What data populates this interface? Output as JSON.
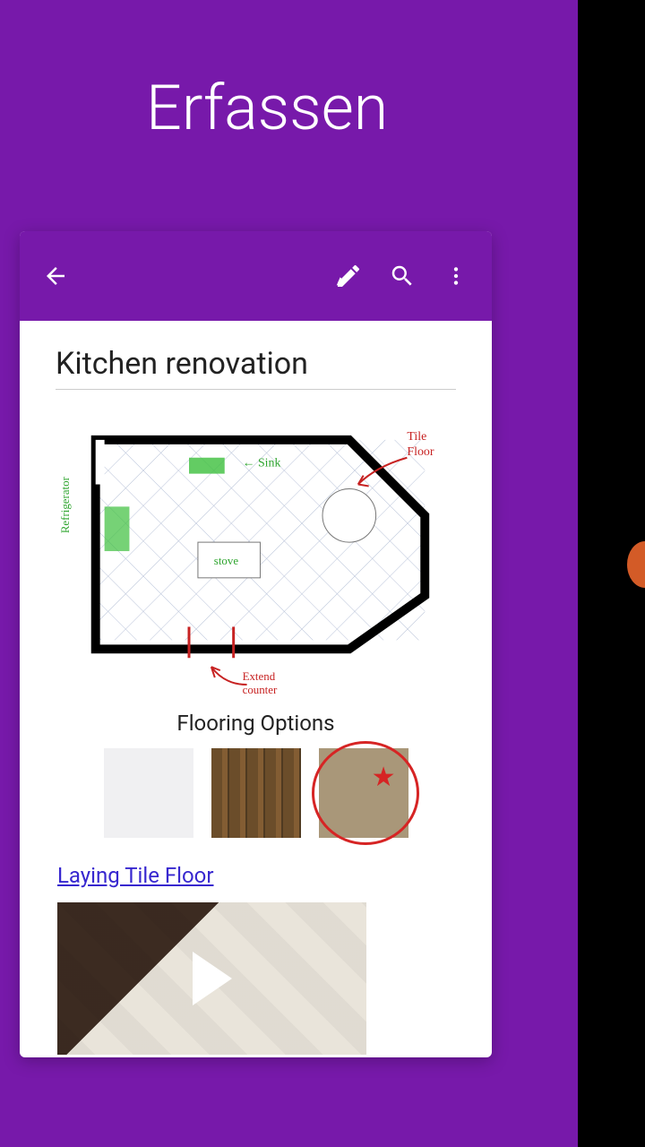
{
  "heading": "Erfassen",
  "note": {
    "title": "Kitchen renovation",
    "floorplan_annotations": {
      "left_green_label": "Refrigerator",
      "sink_label": "Sink",
      "stove_label": "stove",
      "red_right_label": "Tile Floor",
      "red_bottom_label": "Extend counter"
    },
    "flooring_heading": "Flooring Options",
    "link_text": "Laying Tile Floor"
  },
  "icons": {
    "back": "back-arrow",
    "edit_pen": "edit-pen",
    "search": "search",
    "more": "more-vertical",
    "play": "play"
  }
}
